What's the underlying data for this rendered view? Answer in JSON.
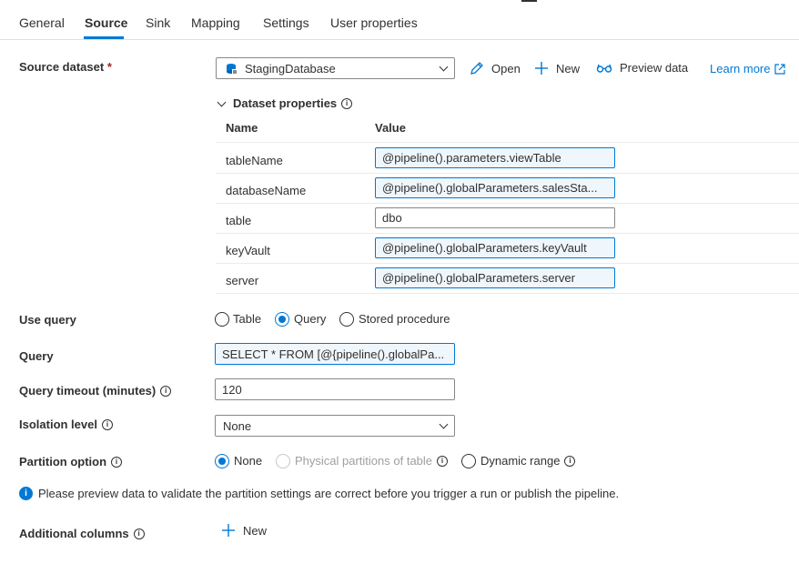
{
  "tabs": [
    {
      "label": "General"
    },
    {
      "label": "Source"
    },
    {
      "label": "Sink"
    },
    {
      "label": "Mapping"
    },
    {
      "label": "Settings"
    },
    {
      "label": "User properties"
    }
  ],
  "active_tab": "Source",
  "source_dataset": {
    "label": "Source dataset",
    "required_mark": "*",
    "selected": "StagingDatabase",
    "open_label": "Open",
    "new_label": "New",
    "preview_label": "Preview data",
    "learn_more_label": "Learn more"
  },
  "dataset_properties": {
    "title": "Dataset properties",
    "col_name": "Name",
    "col_value": "Value",
    "rows": [
      {
        "name": "tableName",
        "value": "@pipeline().parameters.viewTable"
      },
      {
        "name": "databaseName",
        "value": "@pipeline().globalParameters.salesSta..."
      },
      {
        "name": "table",
        "value": "dbo"
      },
      {
        "name": "keyVault",
        "value": "@pipeline().globalParameters.keyVault"
      },
      {
        "name": "server",
        "value": "@pipeline().globalParameters.server"
      }
    ]
  },
  "use_query": {
    "label": "Use query",
    "options": [
      "Table",
      "Query",
      "Stored procedure"
    ],
    "selected": "Query"
  },
  "query": {
    "label": "Query",
    "value": "SELECT * FROM [@{pipeline().globalPa..."
  },
  "query_timeout": {
    "label": "Query timeout (minutes)",
    "value": "120"
  },
  "isolation_level": {
    "label": "Isolation level",
    "value": "None"
  },
  "partition_option": {
    "label": "Partition option",
    "options": [
      "None",
      "Physical partitions of table",
      "Dynamic range"
    ],
    "selected": "None",
    "disabled": "Physical partitions of table"
  },
  "info_message": "Please preview data to validate the partition settings are correct before you trigger a run or publish the pipeline.",
  "additional_columns": {
    "label": "Additional columns",
    "new_label": "New"
  },
  "colors": {
    "accent": "#0078d4",
    "text": "#323130",
    "required": "#a4262c",
    "dynamic_bg": "#eff6fc"
  }
}
